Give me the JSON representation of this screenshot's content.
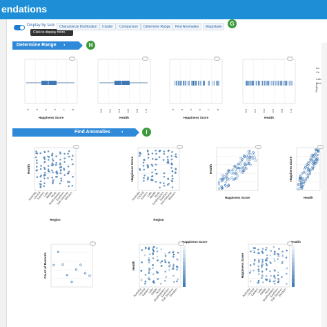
{
  "app": {
    "title": "endations"
  },
  "toolbar": {
    "toggle_label": "Display by task",
    "tooltip": "Click to display more.",
    "tabs": [
      "Characterize Distribution",
      "Cluster",
      "Comparison",
      "Determine Range",
      "Find Anomalies",
      "Magnitude"
    ],
    "badge": "G"
  },
  "sections": {
    "range": {
      "label": "Determine Range",
      "badge": "H"
    },
    "anomalies": {
      "label": "Find Anomalies",
      "badge": "I"
    }
  },
  "range_charts": [
    {
      "type": "boxplot",
      "xlabel": "Happiness Score",
      "ticks": [
        "3",
        "4",
        "5",
        "6",
        "7",
        "8"
      ]
    },
    {
      "type": "boxplot",
      "xlabel": "Health",
      "ticks": [
        "0.0",
        "0.2",
        "0.4",
        "0.6",
        "0.8",
        "1.0"
      ]
    },
    {
      "type": "strip",
      "xlabel": "Happiness Score",
      "ticks": [
        "3",
        "4",
        "5",
        "6",
        "7",
        "8"
      ]
    },
    {
      "type": "strip",
      "xlabel": "Health",
      "ticks": [
        "0.0",
        "0.2",
        "0.4",
        "0.6",
        "0.8",
        "1.0"
      ]
    }
  ],
  "side_notes": [
    "Au",
    "Ce",
    "Latin",
    "Middle E",
    "Region"
  ],
  "anomaly_charts": [
    {
      "type": "strip-cat",
      "ylabel": "Health",
      "xlabel": "Region"
    },
    {
      "type": "strip-cat",
      "ylabel": "Happiness Score",
      "xlabel": "Region"
    },
    {
      "type": "scatter",
      "ylabel": "Health",
      "xlabel": "Happiness Score"
    },
    {
      "type": "scatter",
      "ylabel": "Happiness Score",
      "xlabel": "Health"
    },
    {
      "type": "count-dots",
      "ylabel": "Count of Records",
      "xlabel": ""
    },
    {
      "type": "strip-cat-color",
      "ylabel": "Health",
      "xlabel": "",
      "legend": "Happiness Score"
    },
    {
      "type": "strip-cat-color",
      "ylabel": "Happiness Score",
      "xlabel": "",
      "legend": "Health"
    }
  ],
  "regions": [
    "Australia and New Zealand",
    "Central and Eastern Europe",
    "Eastern Asia",
    "Latin America and Caribbean",
    "Middle East and Northern Africa",
    "North America",
    "Southeastern Asia",
    "Southern Asia",
    "Sub-Saharan Africa",
    "Western Europe"
  ],
  "colors": {
    "accent": "#2e8ad8",
    "badge": "#3c9a3c",
    "dot": "#4a7fb5",
    "titlebar": "#1e8fd6"
  },
  "icons": {
    "more": "ellipsis-icon",
    "chevron": "chevron-right-icon"
  }
}
